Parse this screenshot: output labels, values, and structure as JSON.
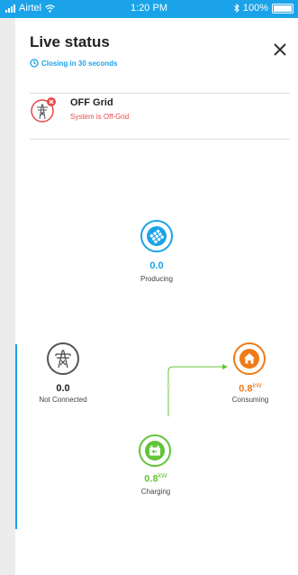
{
  "status_bar": {
    "carrier": "Airtel",
    "time": "1:20 PM",
    "battery": "100%"
  },
  "header": {
    "title": "Live status",
    "closing_text": "Closing in 30 seconds"
  },
  "grid_status": {
    "title": "OFF Grid",
    "subtitle": "System is Off-Grid"
  },
  "nodes": {
    "solar": {
      "value": "0.0",
      "label": "Producing"
    },
    "grid": {
      "value": "0.0",
      "label": "Not Connected"
    },
    "home": {
      "value": "0.8",
      "unit": "kW",
      "label": "Consuming"
    },
    "battery": {
      "value": "0.8",
      "unit": "kW",
      "label": "Charging"
    }
  },
  "colors": {
    "accent": "#1aa3e8",
    "solar": "#1aa3e8",
    "grid": "#555555",
    "home": "#f07b16",
    "battery": "#62c43a",
    "error": "#e64a4a"
  }
}
